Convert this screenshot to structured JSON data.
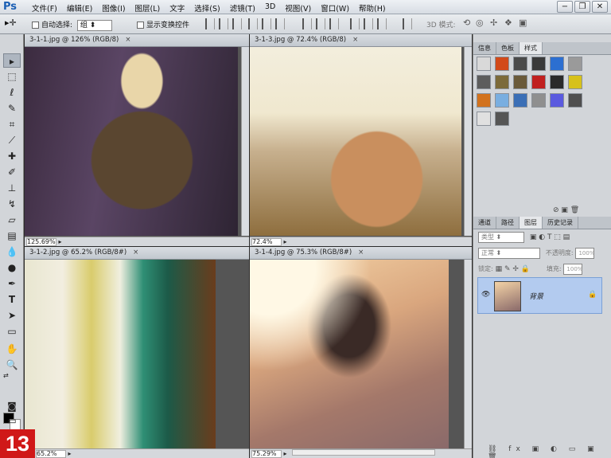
{
  "app": {
    "logo": "Ps"
  },
  "menu": [
    "文件(F)",
    "编辑(E)",
    "图像(I)",
    "图层(L)",
    "文字",
    "选择(S)",
    "滤镜(T)",
    "3D",
    "视图(V)",
    "窗口(W)",
    "帮助(H)"
  ],
  "options": {
    "auto_select_label": "自动选择:",
    "auto_select_value": "组",
    "show_transform_label": "显示变换控件",
    "mode_3d": "3D 模式:"
  },
  "documents": [
    {
      "title": "3-1-1.jpg @ 126% (RGB/8)",
      "zoom": "125.69%"
    },
    {
      "title": "3-1-3.jpg @ 72.4% (RGB/8)",
      "zoom": "72.4%"
    },
    {
      "title": "3-1-2.jpg @ 65.2% (RGB/8#)",
      "zoom": "65.2%"
    },
    {
      "title": "3-1-4.jpg @ 75.3% (RGB/8#)",
      "zoom": "75.29%"
    }
  ],
  "styles_panel": {
    "tabs": [
      "信息",
      "色板",
      "样式"
    ],
    "swatches": [
      "#d9d9d9",
      "#d24a1a",
      "#4a4a4a",
      "#3a3a3a",
      "#2c6fd1",
      "#9a9a9a",
      "#5d5d5d",
      "#7c6a3a",
      "#6a5a3a",
      "#c02020",
      "#2a2a2a",
      "#d7c11b",
      "#d2721e",
      "#79aee0",
      "#3b6fb6",
      "#8f8f8f",
      "#5a5adf",
      "#4f4f4f",
      "#e0e0e0",
      "#555555"
    ]
  },
  "layers_panel": {
    "tabs": [
      "通道",
      "路径",
      "图层",
      "历史记录"
    ],
    "kind": "类型",
    "blend": "正常",
    "opacity_label": "不透明度:",
    "opacity": "100%",
    "lock_label": "锁定:",
    "fill_label": "填充:",
    "fill": "100%",
    "layer_name": "背景"
  },
  "step_number": "13"
}
